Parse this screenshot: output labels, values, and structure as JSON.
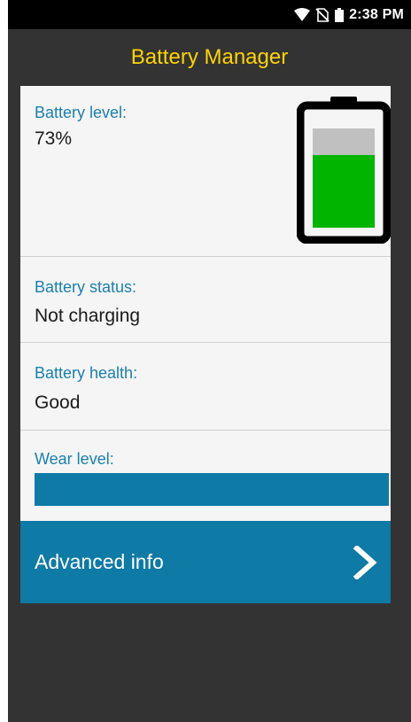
{
  "status_bar": {
    "time": "2:38 PM",
    "icons": [
      "wifi-icon",
      "no-sim-icon",
      "battery-icon"
    ]
  },
  "app": {
    "title": "Battery Manager"
  },
  "battery_level": {
    "label": "Battery level:",
    "value": "73%",
    "fill_fraction": 0.73,
    "colors": {
      "fill": "#00b400",
      "empty": "#c0c0c0",
      "outline": "#000000"
    }
  },
  "battery_status": {
    "label": "Battery status:",
    "value": "Not charging"
  },
  "battery_health": {
    "label": "Battery health:",
    "value": "Good"
  },
  "wear_level": {
    "label": "Wear level:",
    "fill_fraction": 1.0,
    "color": "#0e7aa6"
  },
  "advanced": {
    "label": "Advanced info",
    "icon": "chevron-right-icon"
  },
  "colors": {
    "accent": "#1a7fae",
    "title": "#ffd400",
    "background": "#333333"
  }
}
